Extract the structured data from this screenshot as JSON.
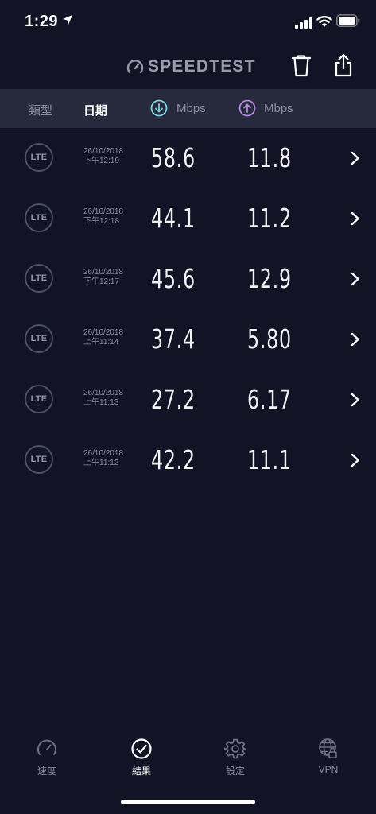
{
  "status_bar": {
    "time": "1:29"
  },
  "header": {
    "logo_text": "SPEEDTEST"
  },
  "columns": {
    "type": "類型",
    "date": "日期",
    "download_unit": "Mbps",
    "upload_unit": "Mbps"
  },
  "colors": {
    "background": "#131326",
    "header_bar": "#272a3c",
    "download_accent": "#7fd6e0",
    "upload_accent": "#b58ae6",
    "muted_text": "#8c8ea0"
  },
  "rows": [
    {
      "type": "LTE",
      "date": "26/10/2018",
      "time": "下午12:19",
      "download": "58.6",
      "upload": "11.8"
    },
    {
      "type": "LTE",
      "date": "26/10/2018",
      "time": "下午12:18",
      "download": "44.1",
      "upload": "11.2"
    },
    {
      "type": "LTE",
      "date": "26/10/2018",
      "time": "下午12:17",
      "download": "45.6",
      "upload": "12.9"
    },
    {
      "type": "LTE",
      "date": "26/10/2018",
      "time": "上午11:14",
      "download": "37.4",
      "upload": "5.80"
    },
    {
      "type": "LTE",
      "date": "26/10/2018",
      "time": "上午11:13",
      "download": "27.2",
      "upload": "6.17"
    },
    {
      "type": "LTE",
      "date": "26/10/2018",
      "time": "上午11:12",
      "download": "42.2",
      "upload": "11.1"
    }
  ],
  "tabs": [
    {
      "label": "速度",
      "icon": "speedometer-icon",
      "active": false
    },
    {
      "label": "結果",
      "icon": "check-circle-icon",
      "active": true
    },
    {
      "label": "設定",
      "icon": "gear-icon",
      "active": false
    },
    {
      "label": "VPN",
      "icon": "globe-lock-icon",
      "active": false
    }
  ]
}
